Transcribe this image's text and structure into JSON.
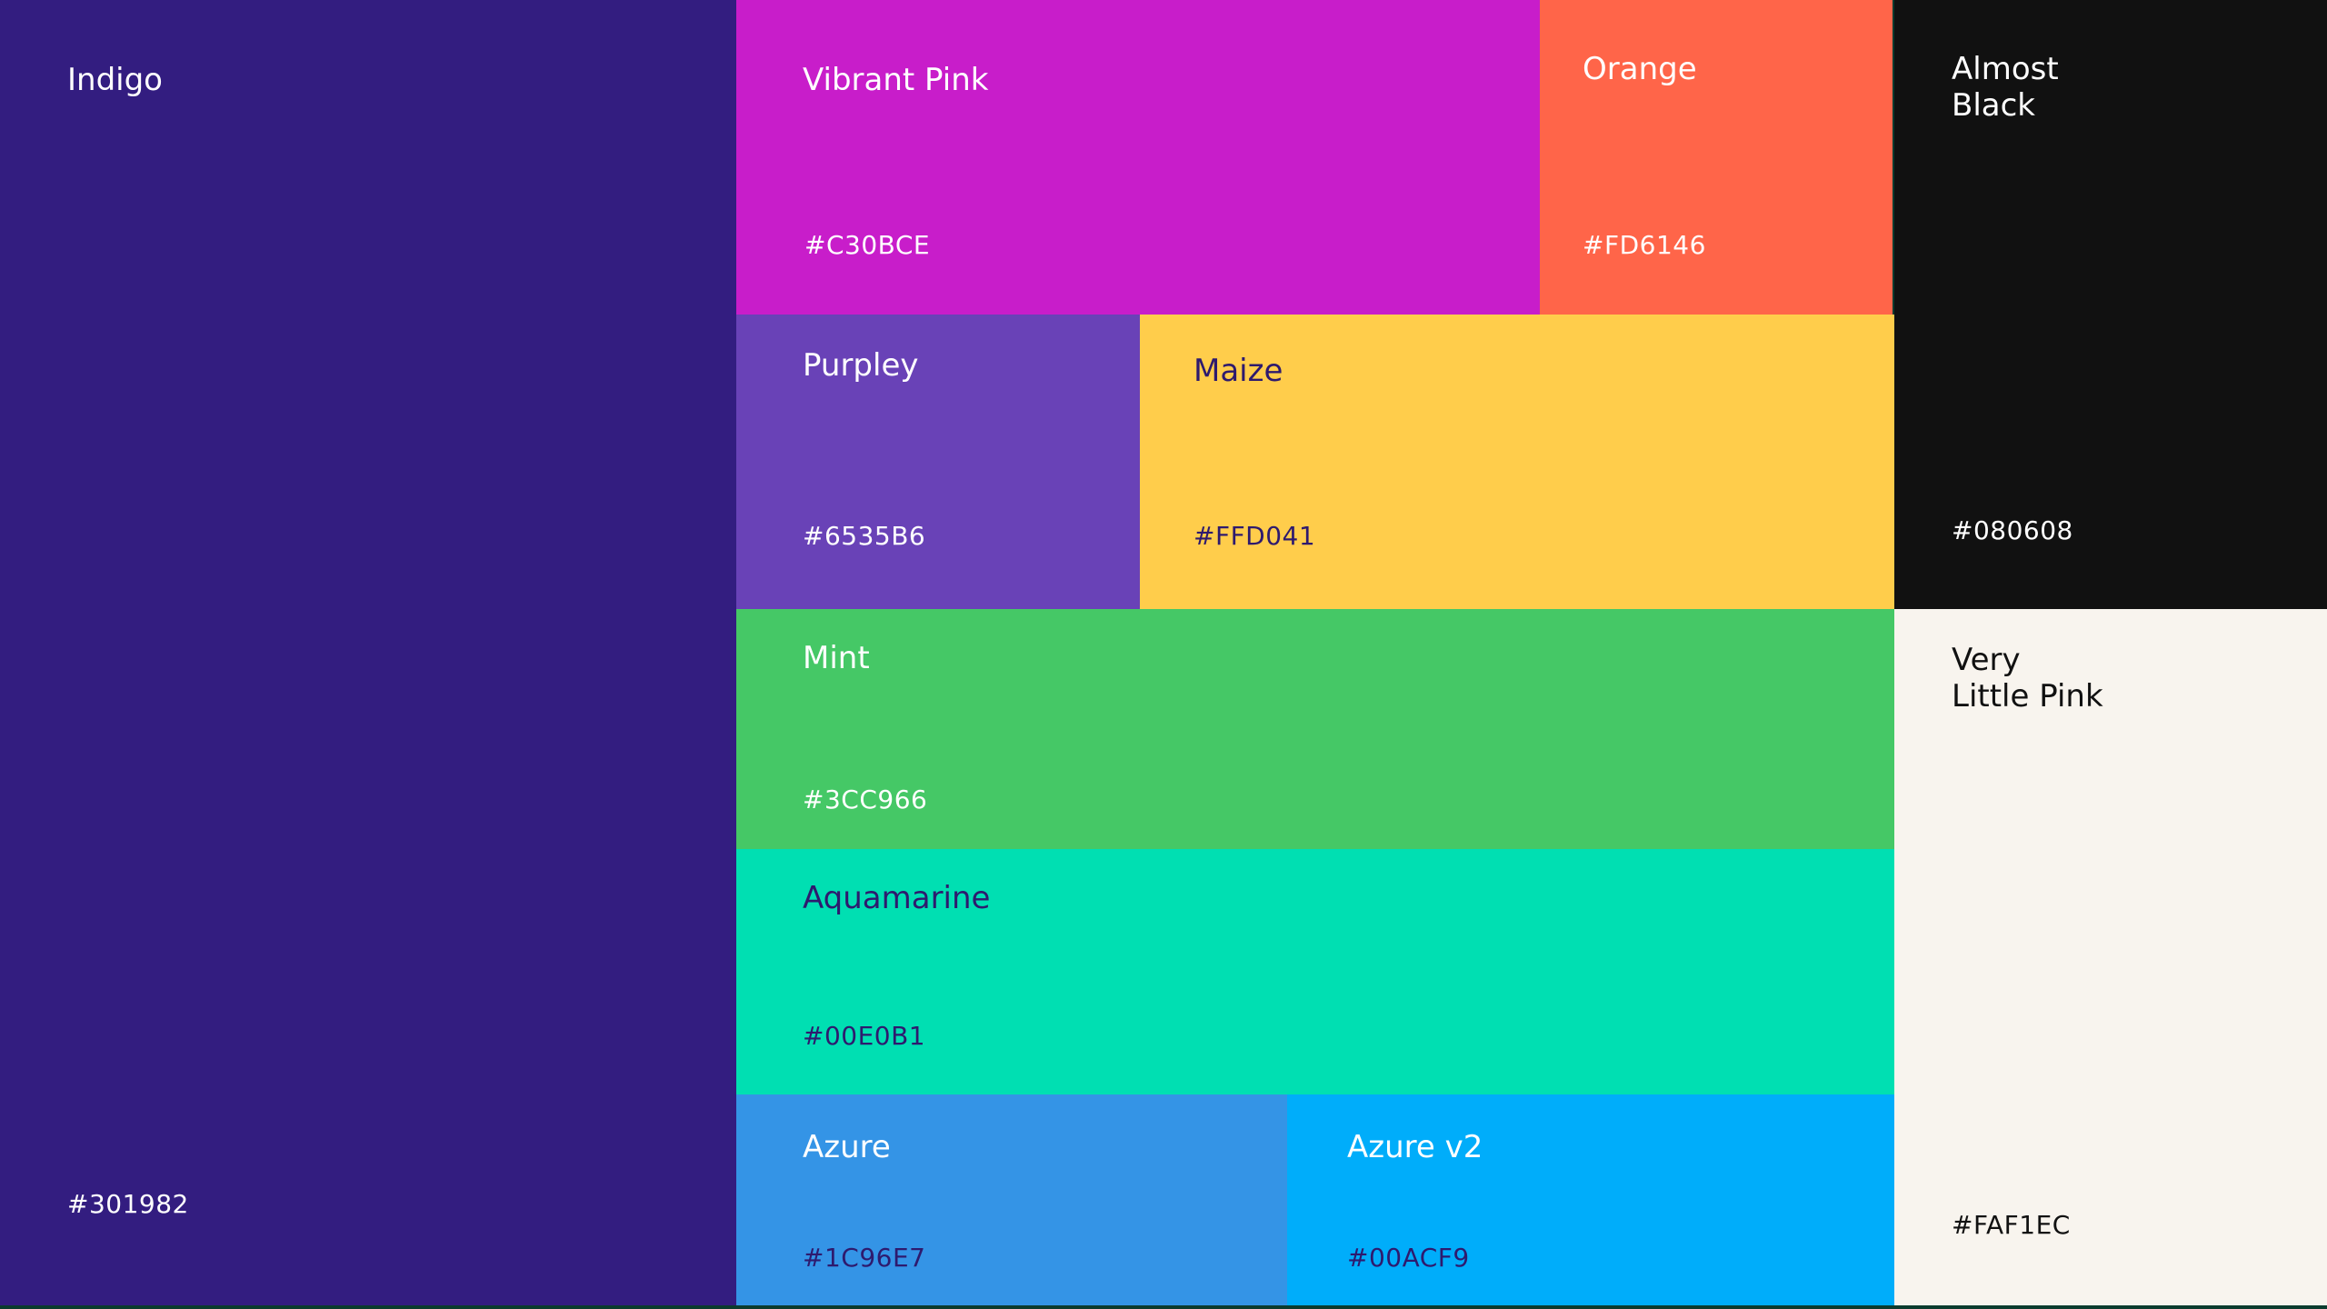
{
  "swatches": [
    {
      "id": "indigo",
      "name": "Indigo",
      "hex": "#301982",
      "color": "#331d80"
    },
    {
      "id": "vibrant-pink",
      "name": "Vibrant Pink",
      "hex": "#C30BCE",
      "color": "#c81dca"
    },
    {
      "id": "orange",
      "name": "Orange",
      "hex": "#FD6146",
      "color": "#ff6549"
    },
    {
      "id": "almost-black",
      "name": "Almost\nBlack",
      "hex": "#080608",
      "color": "#111111"
    },
    {
      "id": "purpley",
      "name": "Purpley",
      "hex": "#6535B6",
      "color": "#6942b7"
    },
    {
      "id": "maize",
      "name": "Maize",
      "hex": "#FFD041",
      "color": "#ffcd4b"
    },
    {
      "id": "mint",
      "name": "Mint",
      "hex": "#3CC966",
      "color": "#45c866"
    },
    {
      "id": "very-little-pink",
      "name": "Very\nLittle Pink",
      "hex": "#FAF1EC",
      "color": "#f8f4ee"
    },
    {
      "id": "aquamarine",
      "name": "Aquamarine",
      "hex": "#00E0B1",
      "color": "#00dfb2"
    },
    {
      "id": "azure",
      "name": "Azure",
      "hex": "#1C96E7",
      "color": "#3494e6"
    },
    {
      "id": "azure-v2",
      "name": "Azure v2",
      "hex": "#00ACF9",
      "color": "#00adfa"
    }
  ]
}
